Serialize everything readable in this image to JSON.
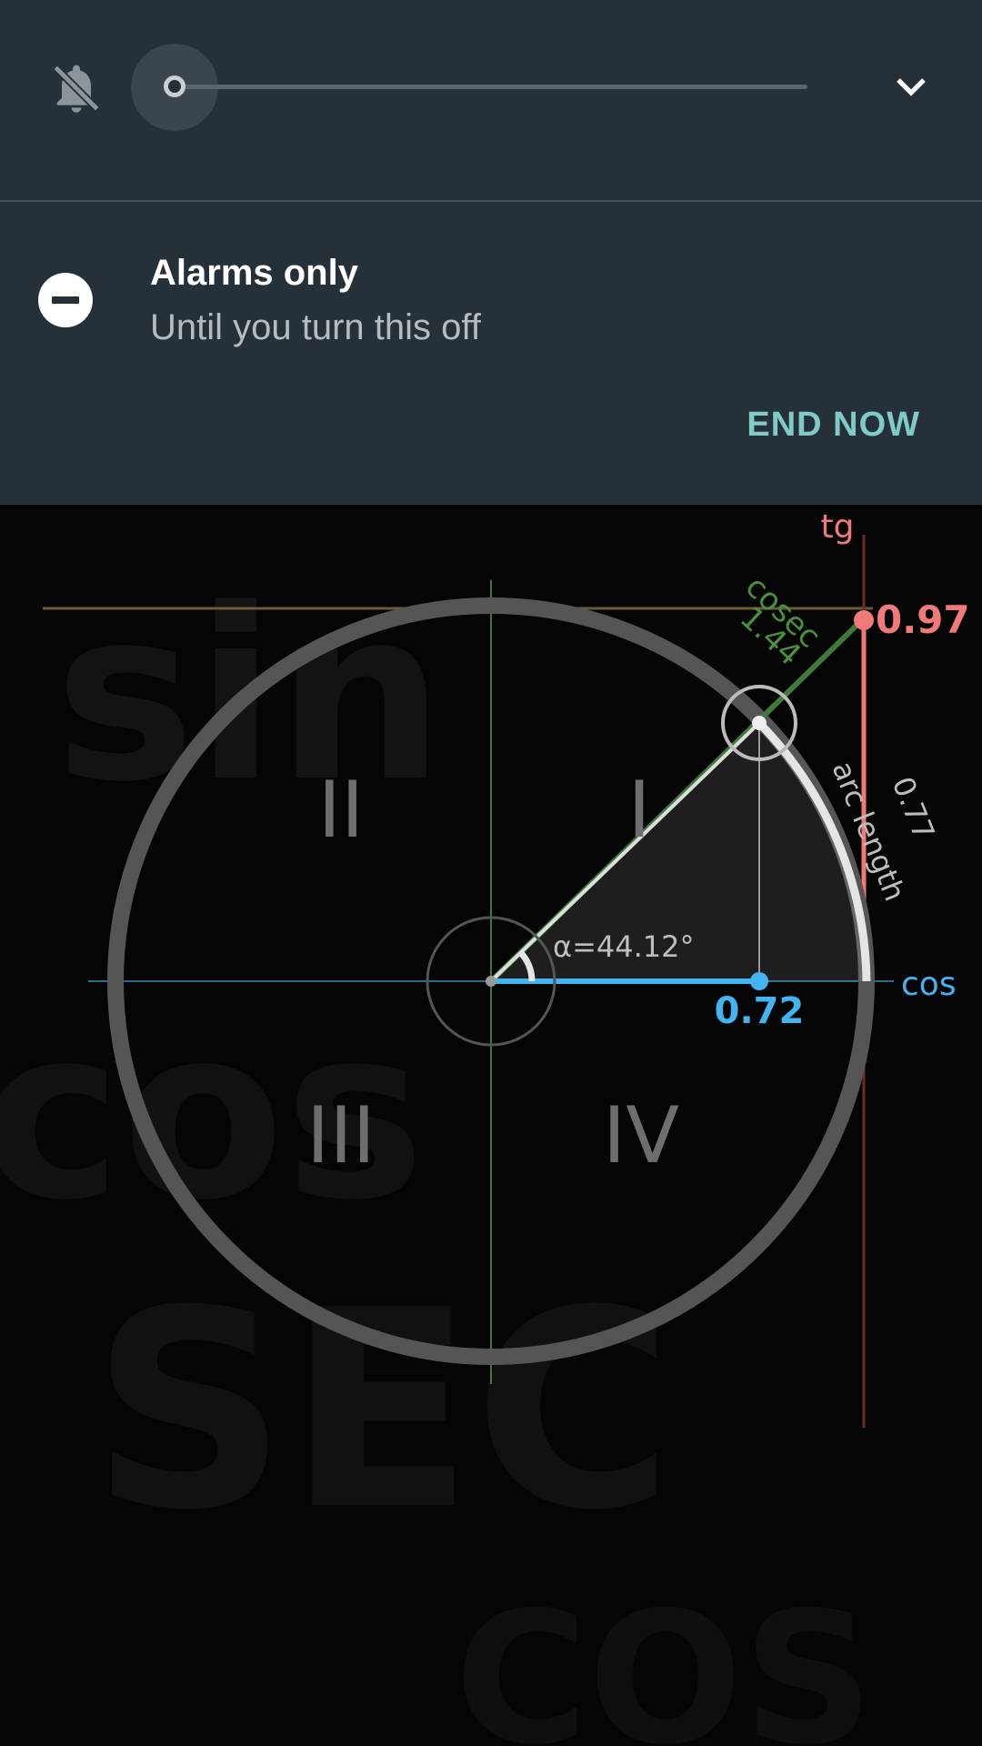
{
  "shade": {
    "mode_title": "Alarms only",
    "mode_subtitle": "Until you turn this off",
    "end_button": "END NOW",
    "volume_level": 0.0,
    "icons": [
      "bell-off-icon",
      "chevron-down-icon",
      "do-not-disturb-icon"
    ]
  },
  "unit_circle": {
    "quadrants": [
      "I",
      "II",
      "III",
      "IV"
    ],
    "angle_label": "α=44.12°",
    "angle_degrees": 44.12,
    "cos_label": "cos",
    "cos_value": "0.72",
    "tg_label": "tg",
    "tg_value": "0.97",
    "cosec_label": "cosec",
    "cosec_value": "1.44",
    "arc_label": "arc length",
    "arc_value": "0.77",
    "colors": {
      "cos": "#42b4f0",
      "tg": "#f07a7a",
      "cosec": "#4a8f3c",
      "circle": "#5a5a5a"
    }
  }
}
